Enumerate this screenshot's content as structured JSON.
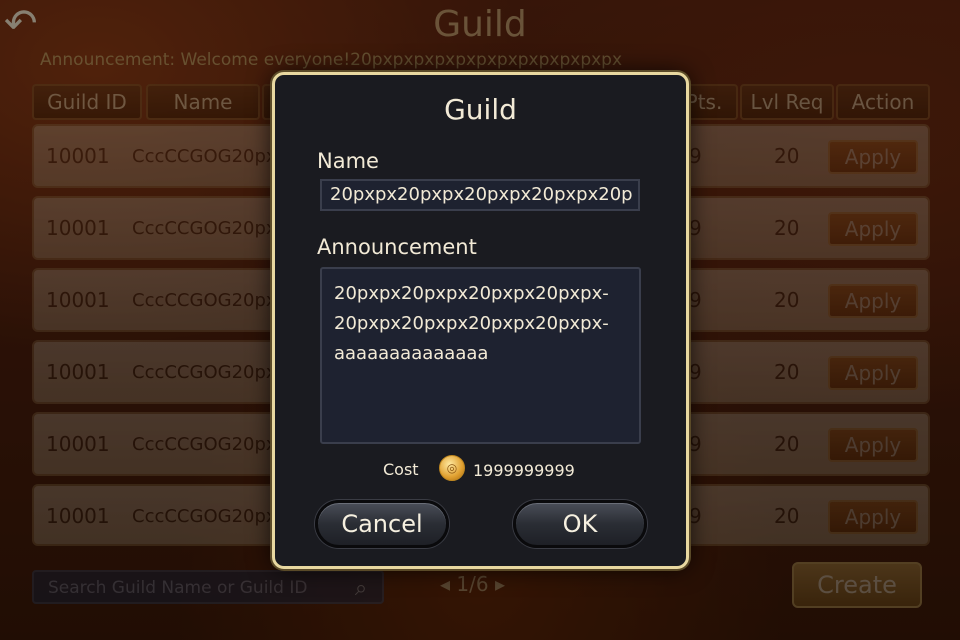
{
  "header": {
    "title": "Guild",
    "announcement": "Announcement: Welcome everyone!20pxpxpxpxpxpxpxpxpxpxpxpx"
  },
  "columns": [
    "Guild ID",
    "Name",
    "Pts.",
    "Lvl Req",
    "Action"
  ],
  "rows": [
    {
      "id": "10001",
      "name": "CccCCGOG20px",
      "pts": "9",
      "lvl": "20",
      "action": "Apply"
    },
    {
      "id": "10001",
      "name": "CccCCGOG20px",
      "pts": "9",
      "lvl": "20",
      "action": "Apply"
    },
    {
      "id": "10001",
      "name": "CccCCGOG20px",
      "pts": "9",
      "lvl": "20",
      "action": "Apply"
    },
    {
      "id": "10001",
      "name": "CccCCGOG20px",
      "pts": "9",
      "lvl": "20",
      "action": "Apply"
    },
    {
      "id": "10001",
      "name": "CccCCGOG20px",
      "pts": "9",
      "lvl": "20",
      "action": "Apply"
    },
    {
      "id": "10001",
      "name": "CccCCGOG20px",
      "pts": "9",
      "lvl": "20",
      "action": "Apply"
    }
  ],
  "search": {
    "placeholder": "Search Guild Name or Guild ID"
  },
  "pager": {
    "text": "1/6"
  },
  "create_label": "Create",
  "modal": {
    "title": "Guild",
    "name_label": "Name",
    "name_value": "20pxpx20pxpx20pxpx20pxpx20p",
    "announcement_label": "Announcement",
    "announcement_lines": [
      "20pxpx20pxpx20pxpx20pxpx-",
      "20pxpx20pxpx20pxpx20pxpx-",
      "aaaaaaaaaaaaaa"
    ],
    "cost_label": "Cost",
    "cost_value": "1999999999",
    "cancel_label": "Cancel",
    "ok_label": "OK"
  },
  "icons": {
    "back": "back-arrow-icon",
    "search": "search-icon",
    "coin": "coin-icon",
    "prev": "chevron-left-icon",
    "next": "chevron-right-icon"
  }
}
